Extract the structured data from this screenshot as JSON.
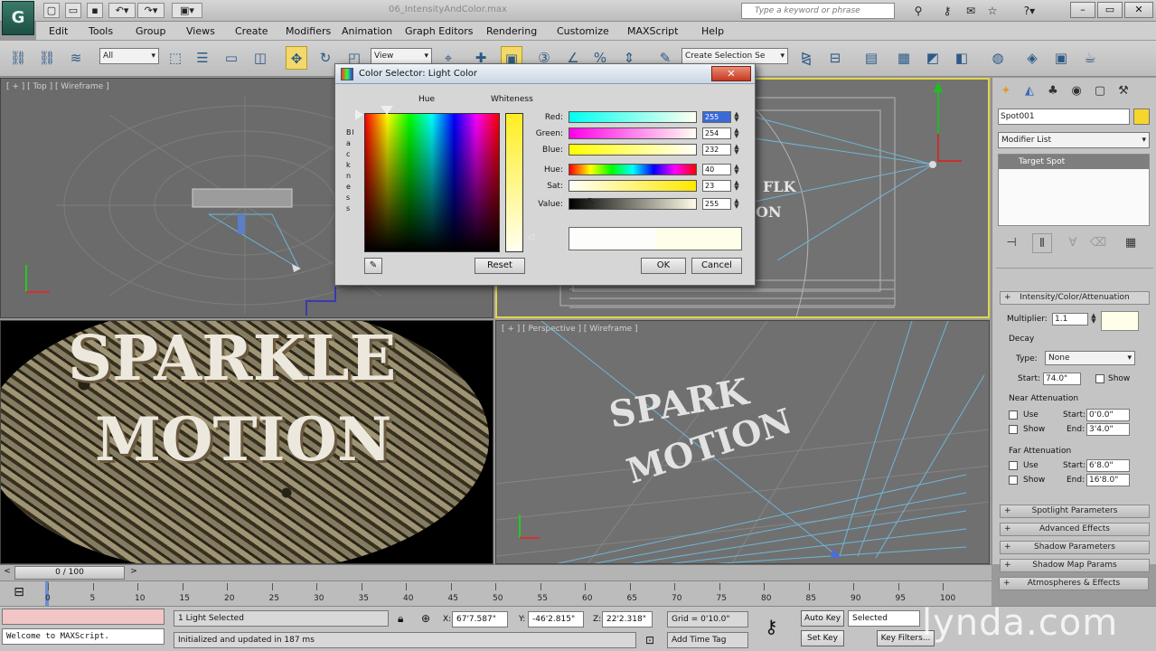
{
  "window": {
    "title": "06_IntensityAndColor.max",
    "search_placeholder": "Type a keyword or phrase"
  },
  "menu": [
    "Edit",
    "Tools",
    "Group",
    "Views",
    "Create",
    "Modifiers",
    "Animation",
    "Graph Editors",
    "Rendering",
    "Customize",
    "MAXScript",
    "Help"
  ],
  "toolbar": {
    "filter_value": "All",
    "refcoord_value": "View",
    "named_selection_placeholder": "Create Selection Se"
  },
  "viewports": {
    "top_label": "[ + ] [ Top ] [ Wireframe ]",
    "persp_label": "[ + ] [ Perspective ] [ Wireframe ]",
    "camera_text_line1": "SPARKLE",
    "camera_text_line2": "MOTION"
  },
  "color_dialog": {
    "title": "Color Selector: Light Color",
    "hue_header": "Hue",
    "whiteness_header": "Whiteness",
    "blackness_label": "Blackness",
    "rows": [
      {
        "label": "Red:",
        "value": "255"
      },
      {
        "label": "Green:",
        "value": "254"
      },
      {
        "label": "Blue:",
        "value": "232"
      },
      {
        "label": "Hue:",
        "value": "40"
      },
      {
        "label": "Sat:",
        "value": "23"
      },
      {
        "label": "Value:",
        "value": "255"
      }
    ],
    "reset_label": "Reset",
    "ok_label": "OK",
    "cancel_label": "Cancel",
    "swatch_old": "#fdfdfb",
    "swatch_new": "#fffee8"
  },
  "command_panel": {
    "object_name": "Spot001",
    "modifier_list": "Modifier List",
    "stack_item": "Target Spot",
    "rollout_intensity": "Intensity/Color/Attenuation",
    "multiplier_label": "Multiplier:",
    "multiplier_value": "1.1",
    "decay_group": "Decay",
    "type_label": "Type:",
    "type_value": "None",
    "start_label": "Start:",
    "decay_start": "74.0\"",
    "show_label": "Show",
    "near_group": "Near Attenuation",
    "use_label": "Use",
    "near_start": "0'0.0\"",
    "end_label": "End:",
    "near_end": "3'4.0\"",
    "far_group": "Far Attenuation",
    "far_start": "6'8.0\"",
    "far_end": "16'8.0\"",
    "rollouts": [
      "Spotlight Parameters",
      "Advanced Effects",
      "Shadow Parameters",
      "Shadow Map Params",
      "Atmospheres & Effects"
    ]
  },
  "timeline": {
    "frame_display": "0 / 100",
    "ticks": [
      "0",
      "5",
      "10",
      "15",
      "20",
      "25",
      "30",
      "35",
      "40",
      "45",
      "50",
      "55",
      "60",
      "65",
      "70",
      "75",
      "80",
      "85",
      "90",
      "95",
      "100"
    ]
  },
  "status": {
    "maxscript_listener": "Welcome to MAXScript.",
    "selection": "1 Light Selected",
    "prompt": "Initialized and updated in 187 ms",
    "x_label": "X:",
    "x_value": "67'7.587\"",
    "y_label": "Y:",
    "y_value": "-46'2.815\"",
    "z_label": "Z:",
    "z_value": "22'2.318\"",
    "grid": "Grid = 0'10.0\"",
    "add_time_tag": "Add Time Tag",
    "auto_key": "Auto Key",
    "selected": "Selected",
    "set_key": "Set Key",
    "key_filters": "Key Filters..."
  },
  "watermark": "lynda.com"
}
